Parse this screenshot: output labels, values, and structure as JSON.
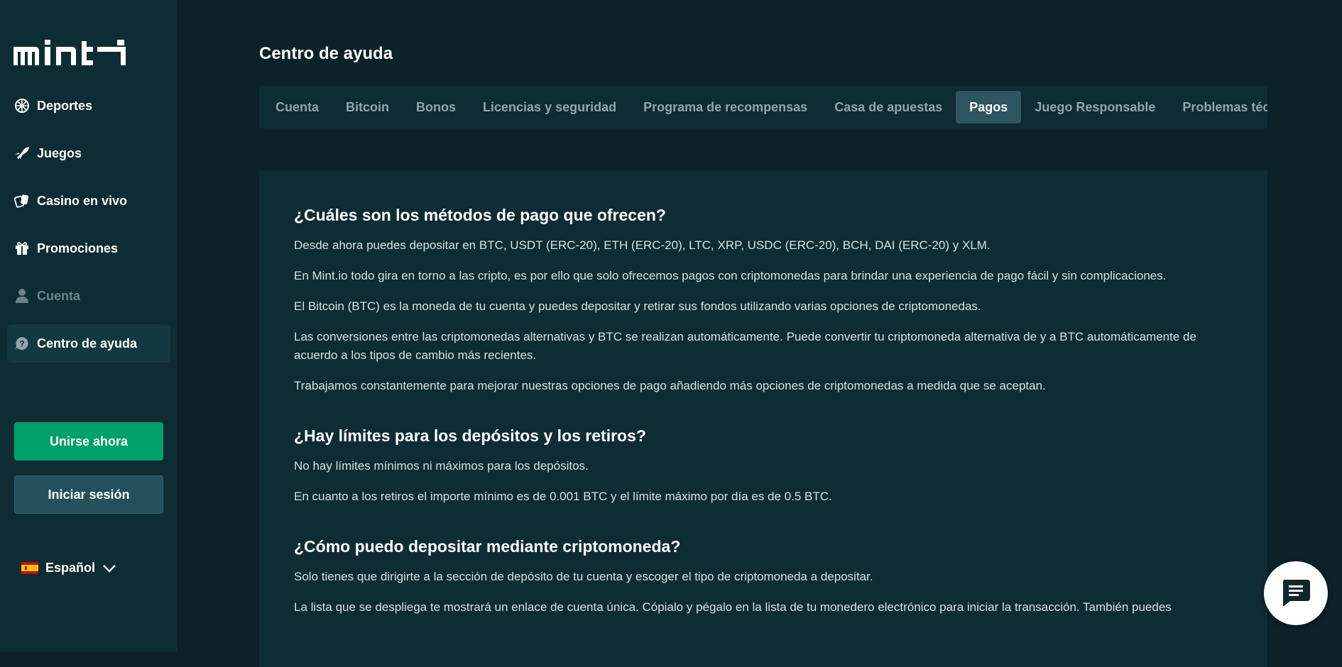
{
  "brand": {
    "logo_text": "mint"
  },
  "sidebar": {
    "items": [
      {
        "label": "Deportes",
        "icon": "sports-ball-icon",
        "state": "normal"
      },
      {
        "label": "Juegos",
        "icon": "rocket-icon",
        "state": "normal"
      },
      {
        "label": "Casino en vivo",
        "icon": "cards-icon",
        "state": "normal"
      },
      {
        "label": "Promociones",
        "icon": "gift-icon",
        "state": "normal"
      },
      {
        "label": "Cuenta",
        "icon": "user-icon",
        "state": "disabled"
      },
      {
        "label": "Centro de ayuda",
        "icon": "help-icon",
        "state": "active"
      }
    ],
    "join_label": "Unirse ahora",
    "login_label": "Iniciar sesión",
    "language": "Español"
  },
  "page": {
    "title": "Centro de ayuda"
  },
  "tabs": [
    {
      "label": "Cuenta"
    },
    {
      "label": "Bitcoin"
    },
    {
      "label": "Bonos"
    },
    {
      "label": "Licencias y seguridad"
    },
    {
      "label": "Programa de recompensas"
    },
    {
      "label": "Casa de apuestas"
    },
    {
      "label": "Pagos",
      "active": true
    },
    {
      "label": "Juego Responsable"
    },
    {
      "label": "Problemas técni"
    }
  ],
  "faq": [
    {
      "question": "¿Cuáles son los métodos de pago que ofrecen?",
      "answers": [
        "Desde ahora puedes depositar en BTC, USDT (ERC-20), ETH (ERC-20), LTC, XRP, USDC (ERC-20), BCH, DAI (ERC-20) y XLM.",
        "En Mint.io todo gira en torno a las cripto, es por ello que solo ofrecemos pagos con criptomonedas para brindar una experiencia de pago fácil y sin complicaciones.",
        "El Bitcoin (BTC) es la moneda de tu cuenta y puedes depositar y retirar sus fondos utilizando varias opciones de criptomonedas.",
        "Las conversiones entre las criptomonedas alternativas y BTC se realizan automáticamente. Puede convertir tu criptomoneda alternativa de y a BTC automáticamente de acuerdo a los tipos de cambio más recientes.",
        "Trabajamos constantemente para mejorar nuestras opciones de pago añadiendo más opciones de criptomonedas a medida que se aceptan."
      ]
    },
    {
      "question": "¿Hay límites para los depósitos y los retiros?",
      "answers": [
        "No hay límites mínimos ni máximos para los depósitos.",
        "En cuanto a los retiros el importe mínimo es de 0.001 BTC y el límite máximo por día es de 0.5 BTC."
      ]
    },
    {
      "question": "¿Cómo puedo depositar mediante criptomoneda?",
      "answers": [
        "Solo tienes que dirigirte a la sección de depósito de tu cuenta y escoger el tipo de criptomoneda a depositar.",
        "La lista que se despliega te mostrará un enlace de cuenta única. Cópialo y pégalo en la lista de tu monedero electrónico para iniciar la transacción. También puedes"
      ]
    }
  ],
  "chat": {
    "icon": "chat-icon"
  },
  "colors": {
    "accent": "#00a06a",
    "sidebar_bg": "#0e2c33",
    "page_bg": "#0b2229",
    "active_tab": "#2e5560"
  }
}
